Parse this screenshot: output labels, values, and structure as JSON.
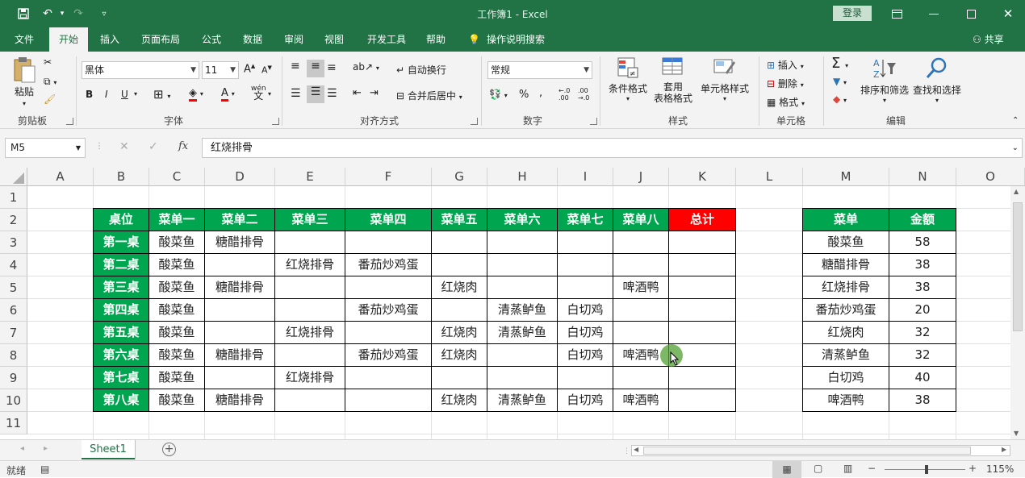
{
  "titlebar": {
    "title": "工作簿1  -  Excel",
    "login": "登录",
    "accent": "#217346"
  },
  "tabs": [
    "文件",
    "开始",
    "插入",
    "页面布局",
    "公式",
    "数据",
    "审阅",
    "视图",
    "开发工具",
    "帮助"
  ],
  "active_tab": "开始",
  "tellme": "操作说明搜索",
  "share": "共享",
  "ribbon": {
    "clipboard": {
      "paste": "粘贴",
      "label": "剪贴板"
    },
    "font": {
      "name": "黑体",
      "size": "11",
      "label": "字体",
      "bold": "B",
      "italic": "I",
      "underline": "U"
    },
    "alignment": {
      "wrap": "自动换行",
      "merge": "合并后居中",
      "label": "对齐方式"
    },
    "number": {
      "format": "常规",
      "percent": "%",
      "comma": ",",
      "label": "数字"
    },
    "styles": {
      "conditional": "条件格式",
      "table_line1": "套用",
      "table_line2": "表格格式",
      "cell_styles": "单元格样式",
      "label": "样式"
    },
    "cells": {
      "insert": "插入",
      "delete": "删除",
      "format": "格式",
      "label": "单元格"
    },
    "editing": {
      "sort": "排序和筛选",
      "find": "查找和选择",
      "label": "编辑"
    }
  },
  "formula_bar": {
    "name_box": "M5",
    "value": "红烧排骨"
  },
  "columns": [
    "A",
    "B",
    "C",
    "D",
    "E",
    "F",
    "G",
    "H",
    "I",
    "J",
    "K",
    "L",
    "M",
    "N",
    "O"
  ],
  "rows": [
    "1",
    "2",
    "3",
    "4",
    "5",
    "6",
    "7",
    "8",
    "9",
    "10",
    "11"
  ],
  "table1": {
    "headers": [
      "桌位",
      "菜单一",
      "菜单二",
      "菜单三",
      "菜单四",
      "菜单五",
      "菜单六",
      "菜单七",
      "菜单八",
      "总计"
    ],
    "rows": [
      [
        "第一桌",
        "酸菜鱼",
        "糖醋排骨",
        "",
        "",
        "",
        "",
        "",
        "",
        ""
      ],
      [
        "第二桌",
        "酸菜鱼",
        "",
        "红烧排骨",
        "番茄炒鸡蛋",
        "",
        "",
        "",
        "",
        ""
      ],
      [
        "第三桌",
        "酸菜鱼",
        "糖醋排骨",
        "",
        "",
        "红烧肉",
        "",
        "",
        "啤酒鸭",
        ""
      ],
      [
        "第四桌",
        "酸菜鱼",
        "",
        "",
        "番茄炒鸡蛋",
        "",
        "清蒸鲈鱼",
        "白切鸡",
        "",
        ""
      ],
      [
        "第五桌",
        "酸菜鱼",
        "",
        "红烧排骨",
        "",
        "红烧肉",
        "清蒸鲈鱼",
        "白切鸡",
        "",
        ""
      ],
      [
        "第六桌",
        "酸菜鱼",
        "糖醋排骨",
        "",
        "番茄炒鸡蛋",
        "红烧肉",
        "",
        "白切鸡",
        "啤酒鸭",
        ""
      ],
      [
        "第七桌",
        "酸菜鱼",
        "",
        "红烧排骨",
        "",
        "",
        "",
        "",
        "",
        ""
      ],
      [
        "第八桌",
        "酸菜鱼",
        "糖醋排骨",
        "",
        "",
        "红烧肉",
        "清蒸鲈鱼",
        "白切鸡",
        "啤酒鸭",
        ""
      ]
    ],
    "header_color": "#00a64f",
    "total_color": "#ff0000"
  },
  "table2": {
    "headers": [
      "菜单",
      "金额"
    ],
    "rows": [
      [
        "酸菜鱼",
        "58"
      ],
      [
        "糖醋排骨",
        "38"
      ],
      [
        "红烧排骨",
        "38"
      ],
      [
        "番茄炒鸡蛋",
        "20"
      ],
      [
        "红烧肉",
        "32"
      ],
      [
        "清蒸鲈鱼",
        "32"
      ],
      [
        "白切鸡",
        "40"
      ],
      [
        "啤酒鸭",
        "38"
      ]
    ]
  },
  "sheet_tab": "Sheet1",
  "status": {
    "ready": "就绪",
    "zoom": "115%"
  }
}
